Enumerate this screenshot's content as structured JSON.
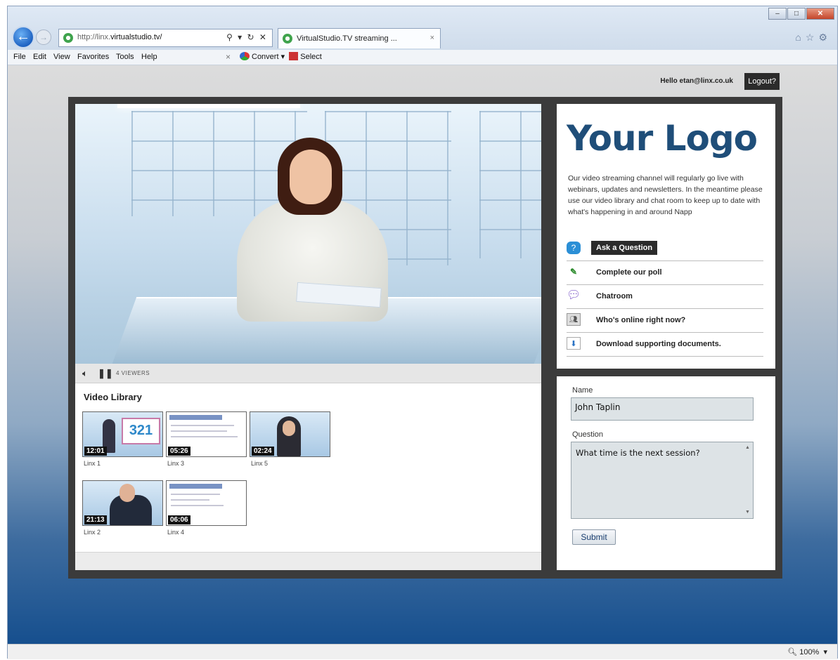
{
  "browser": {
    "url_prefix": "http://linx.",
    "url_domain": "virtualstudio.tv/",
    "address_icons": "⚲ ▾ ↻ ✕",
    "tab_title": "VirtualStudio.TV streaming ...",
    "tab_close": "×",
    "menu": [
      "File",
      "Edit",
      "View",
      "Favorites",
      "Tools",
      "Help"
    ],
    "toolbar_close": "×",
    "convert_label": "Convert",
    "convert_arrow": "▾",
    "select_label": "Select",
    "zoom_label": "100%",
    "zoom_arrow": "▾"
  },
  "header": {
    "greeting": "Hello etan@linx.co.uk",
    "logout_label": "Logout?"
  },
  "player": {
    "viewers_label": "4 VIEWERS"
  },
  "library": {
    "title": "Video Library",
    "videos": [
      {
        "duration": "12:01",
        "caption": "Linx 1"
      },
      {
        "duration": "05:26",
        "caption": "Linx 3"
      },
      {
        "duration": "02:24",
        "caption": "Linx 5"
      },
      {
        "duration": "21:13",
        "caption": "Linx 2"
      },
      {
        "duration": "06:06",
        "caption": "Linx 4"
      }
    ],
    "thumb1_badge": "321"
  },
  "info": {
    "logo": "Your Logo",
    "blurb": "Our video streaming channel will regularly go live with webinars, updates and newsletters. In the meantime please use our video library and chat room to keep up to date with what's happening in and around Napp",
    "actions": [
      {
        "label": "Ask a Question",
        "icon": "question-bubble-icon"
      },
      {
        "label": "Complete our poll",
        "icon": "poll-icon"
      },
      {
        "label": "Chatroom",
        "icon": "chat-icon"
      },
      {
        "label": "Who's online right now?",
        "icon": "users-online-icon"
      },
      {
        "label": "Download supporting documents.",
        "icon": "download-icon"
      }
    ]
  },
  "form": {
    "name_label": "Name",
    "name_value": "John Taplin",
    "question_label": "Question",
    "question_value": "What time is the next session?",
    "submit_label": "Submit"
  },
  "colors": {
    "logo": "#1f4e79",
    "frame": "#3b3b3b",
    "page_gradient_bottom": "#164f8e"
  }
}
